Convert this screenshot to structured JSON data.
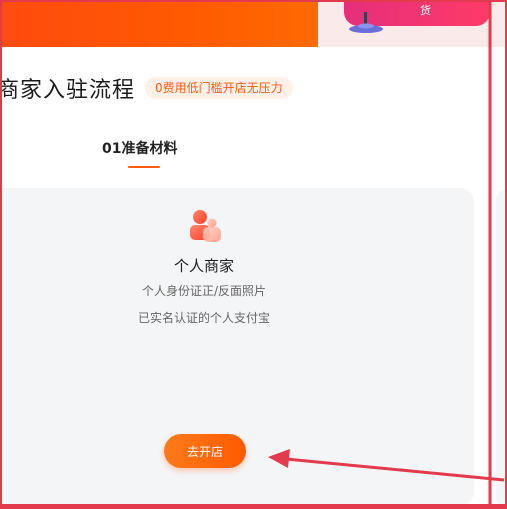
{
  "banner": {
    "promo_text": "货"
  },
  "header": {
    "title": "商家入驻流程",
    "tag": "0费用低门槛开店无压力"
  },
  "steps": [
    {
      "label": "01准备材料",
      "active": true
    }
  ],
  "card": {
    "title": "个人商家",
    "requirements": [
      "个人身份证正/反面照片",
      "已实名认证的个人支付宝"
    ],
    "button_label": "去开店"
  },
  "colors": {
    "brand_orange": "#ff5a00",
    "annotation_red": "#e33a4d",
    "card_bg": "#f4f5f7"
  },
  "icons": {
    "merchant": "merchant-icon",
    "arrow": "annotation-arrow"
  }
}
